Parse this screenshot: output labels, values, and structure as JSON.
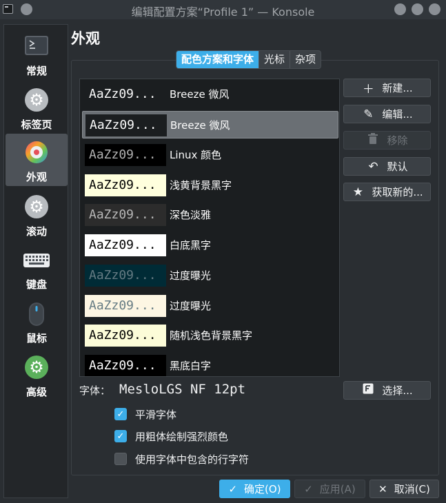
{
  "window": {
    "title": "编辑配置方案“Profile 1” — Konsole"
  },
  "sidebar": {
    "items": [
      {
        "label": "常规",
        "icon": "terminal-icon"
      },
      {
        "label": "标签页",
        "icon": "gear-icon"
      },
      {
        "label": "外观",
        "icon": "color-wheel-icon"
      },
      {
        "label": "滚动",
        "icon": "gear-icon"
      },
      {
        "label": "键盘",
        "icon": "keyboard-icon"
      },
      {
        "label": "鼠标",
        "icon": "mouse-icon"
      },
      {
        "label": "高级",
        "icon": "gear-icon"
      }
    ],
    "active_index": 2
  },
  "page": {
    "title": "外观"
  },
  "tabs": [
    {
      "label": "配色方案和字体",
      "active": true
    },
    {
      "label": "光标",
      "active": false
    },
    {
      "label": "杂项",
      "active": false
    }
  ],
  "schemes": {
    "preview_text": "AaZz09...",
    "items": [
      {
        "name": "Breeze 微风",
        "bg": "#1b1e20",
        "fg": "#fcfcfc",
        "selected": false
      },
      {
        "name": "Breeze 微风",
        "bg": "#1b1e20",
        "fg": "#fcfcfc",
        "selected": true
      },
      {
        "name": "Linux 颜色",
        "bg": "#000000",
        "fg": "#b2b2b2",
        "selected": false
      },
      {
        "name": "浅黄背景黑字",
        "bg": "#ffffdd",
        "fg": "#000000",
        "selected": false
      },
      {
        "name": "深色淡雅",
        "bg": "#2c2c2c",
        "fg": "#b9b9b9",
        "selected": false
      },
      {
        "name": "白底黑字",
        "bg": "#ffffff",
        "fg": "#000000",
        "selected": false
      },
      {
        "name": "过度曝光",
        "bg": "#002b36",
        "fg": "#657b83",
        "selected": false
      },
      {
        "name": "过度曝光",
        "bg": "#fdf6e3",
        "fg": "#657b83",
        "selected": false
      },
      {
        "name": "随机浅色背景黑字",
        "bg": "#fcfcd8",
        "fg": "#000000",
        "selected": false
      },
      {
        "name": "黑底白字",
        "bg": "#000000",
        "fg": "#ffffff",
        "selected": false
      }
    ]
  },
  "actions": {
    "new": "新建...",
    "edit": "编辑...",
    "remove": "移除",
    "default": "默认",
    "get_new": "获取新的..."
  },
  "font": {
    "label": "字体：",
    "value": "MesloLGS NF 12pt",
    "choose": "选择..."
  },
  "options": [
    {
      "label": "平滑字体",
      "checked": true
    },
    {
      "label": "用粗体绘制强烈颜色",
      "checked": true
    },
    {
      "label": "使用字体中包含的行字符",
      "checked": false
    }
  ],
  "footer": {
    "ok": "确定(O)",
    "apply": "应用(A)",
    "cancel": "取消(C)"
  },
  "colors": {
    "accent": "#3daee9",
    "background": "#2a2e32"
  }
}
